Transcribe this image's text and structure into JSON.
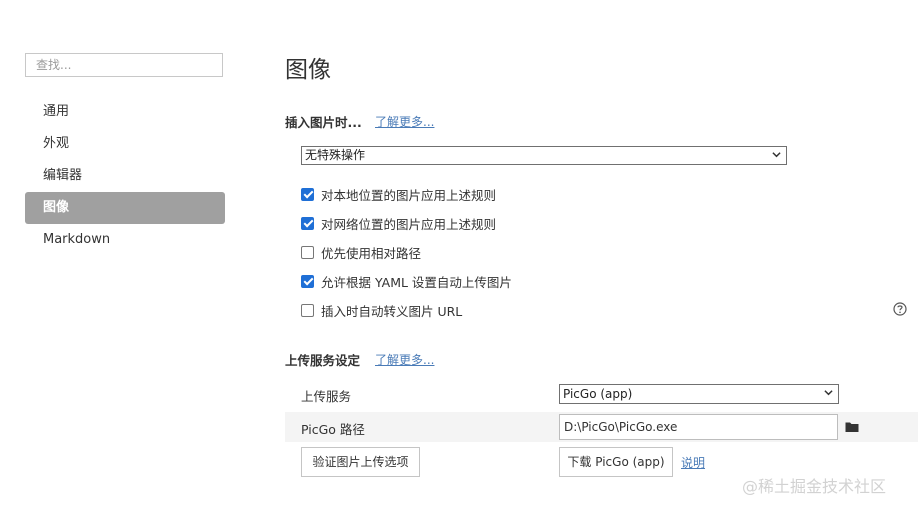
{
  "sidebar": {
    "search_placeholder": "查找...",
    "items": [
      {
        "label": "通用"
      },
      {
        "label": "外观"
      },
      {
        "label": "编辑器"
      },
      {
        "label": "图像"
      },
      {
        "label": "Markdown"
      }
    ]
  },
  "main": {
    "title": "图像",
    "insert": {
      "title": "插入图片时...",
      "learn_more": "了解更多...",
      "select_value": "无特殊操作",
      "options": [
        {
          "label": "对本地位置的图片应用上述规则",
          "checked": true
        },
        {
          "label": "对网络位置的图片应用上述规则",
          "checked": true
        },
        {
          "label": "优先使用相对路径",
          "checked": false
        },
        {
          "label": "允许根据 YAML 设置自动上传图片",
          "checked": true
        },
        {
          "label": "插入时自动转义图片 URL",
          "checked": false
        }
      ]
    },
    "upload": {
      "title": "上传服务设定",
      "learn_more": "了解更多...",
      "service_label": "上传服务",
      "service_value": "PicGo (app)",
      "path_label": "PicGo 路径",
      "path_value": "D:\\PicGo\\PicGo.exe",
      "verify_button": "验证图片上传选项",
      "download_button": "下载 PicGo (app)",
      "explain_link": "说明"
    }
  },
  "watermark": "@稀土掘金技术社区",
  "colors": {
    "active_nav_bg": "#a0a0a0",
    "checkbox_checked": "#1f6fd6",
    "link": "#4a7bb7"
  }
}
